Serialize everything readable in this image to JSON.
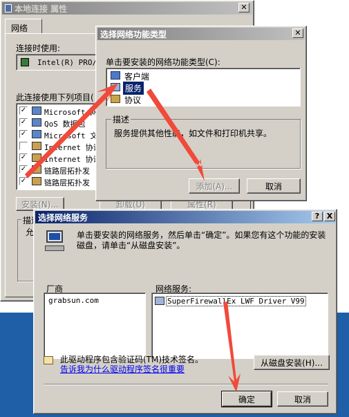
{
  "props_window": {
    "title": "本地连接 属性",
    "tab": "网络",
    "connect_using_label": "连接时使用:",
    "adapter": "Intel(R) PRO/1(",
    "items_label": "此连接使用下列项目(",
    "items": [
      {
        "label": "Microsoft 网",
        "checked": true
      },
      {
        "label": "QoS 数据包",
        "checked": true
      },
      {
        "label": "Microsoft 文",
        "checked": true
      },
      {
        "label": "Internet 协议",
        "checked": false
      },
      {
        "label": "Internet 协议",
        "checked": true
      },
      {
        "label": "链路层拓扑发",
        "checked": true
      },
      {
        "label": "链路层拓扑发",
        "checked": true
      }
    ],
    "install_btn": "安装(N)...",
    "uninstall_btn": "卸载(U)",
    "properties_btn": "属性(R)",
    "desc_label": "描述",
    "desc_text": "允"
  },
  "feature_dialog": {
    "title": "选择网络功能类型",
    "prompt": "单击要安装的网络功能类型(C):",
    "items": [
      "客户端",
      "服务",
      "协议"
    ],
    "selected_index": 1,
    "desc_label": "描述",
    "desc_text": "服务提供其他性能，如文件和打印机共享。",
    "add_btn": "添加(A)...",
    "cancel_btn": "取消"
  },
  "service_dialog": {
    "title": "选择网络服务",
    "help_btn": "?",
    "close_btn": "X",
    "instruction": "单击要安装的网络服务，然后单击“确定”。如果您有这个功能的安装磁盘，请单击“从磁盘安装”。",
    "vendor_header": "厂商",
    "vendors": [
      "grabsun.com"
    ],
    "service_header": "网络服务:",
    "services": [
      "SuperFirewallEx LWF Driver V99"
    ],
    "signed_text": "此驱动程序包含验证码(TM)技术签名。",
    "signing_link": "告诉我为什么驱动程序签名很重要",
    "have_disk_btn": "从磁盘安装(H)...",
    "ok_btn": "确定",
    "cancel_btn": "取消"
  },
  "colors": {
    "arrow": "#f04a3a",
    "title_active": "#0a246a",
    "desktop": "#1f5fa8"
  }
}
